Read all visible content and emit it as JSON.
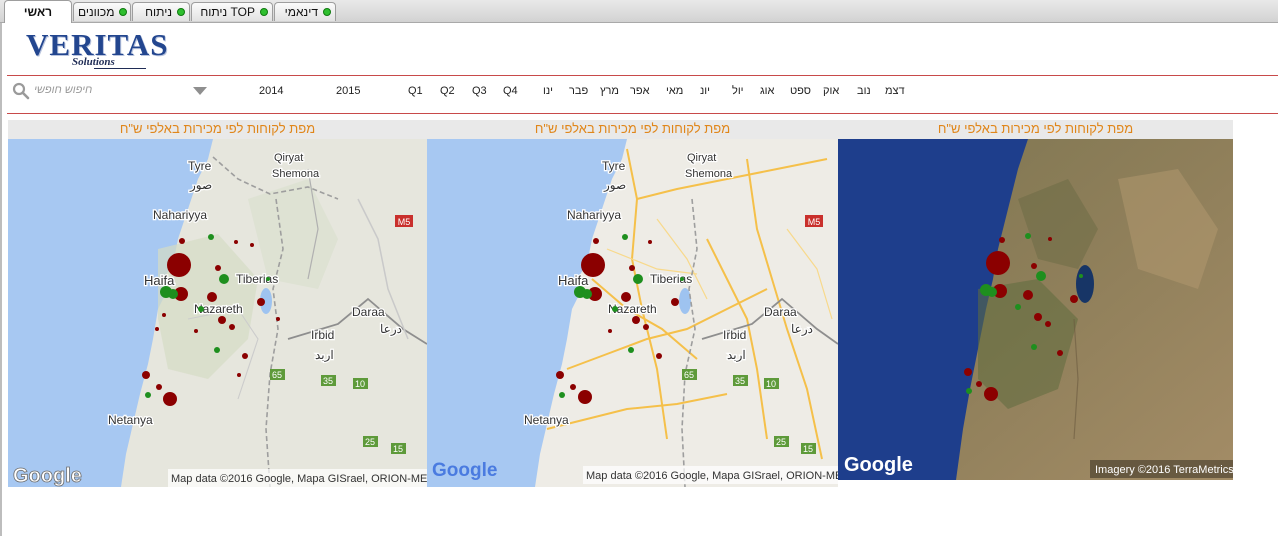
{
  "tabs": [
    {
      "label": "ראשי",
      "active": true
    },
    {
      "label": "מכוונים"
    },
    {
      "label": "ניתוח"
    },
    {
      "label": "ניתוח TOP"
    },
    {
      "label": "דינאמי"
    }
  ],
  "logo": {
    "title": "VERITAS",
    "subtitle": "Solutions"
  },
  "search": {
    "placeholder": "חיפוש חופשי"
  },
  "years": [
    "2014",
    "2015"
  ],
  "quarters": [
    "Q1",
    "Q2",
    "Q3",
    "Q4"
  ],
  "months": [
    "ינו",
    "פבר",
    "מרץ",
    "אפר",
    "מאי",
    "יונ",
    "יול",
    "אוג",
    "ספט",
    "אוק",
    "נוב",
    "דצמ"
  ],
  "panels": [
    {
      "title": "מפת לקוחות לפי מכירות באלפי ש\"ח",
      "map_type": "terrain",
      "attribution": "Map data ©2016 Google, Mapa GISrael, ORION-ME",
      "labels": {
        "tyre": "Tyre",
        "tyre_ar": "صور",
        "qiryat1": "Qiryat",
        "qiryat2": "Shemona",
        "nahariyya": "Nahariyya",
        "haifa": "Haifa",
        "tiberias": "Tiberias",
        "nazareth": "Nazareth",
        "daraa": "Daraa",
        "daraa_ar": "درعا",
        "irbid": "Irbid",
        "irbid_ar": "اربد",
        "netanya": "Netanya"
      },
      "road_shields": {
        "m5": "M5",
        "r65": "65",
        "r35": "35",
        "r10": "10",
        "r25": "25",
        "r15": "15"
      }
    },
    {
      "title": "מפת לקוחות לפי מכירות באלפי ש\"ח",
      "map_type": "roadmap",
      "attribution": "Map data ©2016 Google, Mapa GISrael, ORION-ME",
      "labels": {
        "tyre": "Tyre",
        "tyre_ar": "صور",
        "qiryat1": "Qiryat",
        "qiryat2": "Shemona",
        "nahariyya": "Nahariyya",
        "haifa": "Haifa",
        "tiberias": "Tiberias",
        "nazareth": "Nazareth",
        "daraa": "Daraa",
        "daraa_ar": "درعا",
        "irbid": "Irbid",
        "irbid_ar": "اربد",
        "netanya": "Netanya"
      },
      "road_shields": {
        "m5": "M5",
        "r65": "65",
        "r35": "35",
        "r10": "10",
        "r25": "25",
        "r15": "15"
      }
    },
    {
      "title": "מפת לקוחות לפי מכירות באלפי ש\"ח",
      "map_type": "satellite",
      "attribution": "Imagery ©2016 TerraMetrics"
    }
  ],
  "google_logo": "Google",
  "colors": {
    "accent_title": "#e0861a",
    "marker_red": "#8b0000",
    "marker_green": "#1e8f1e",
    "rule": "#c84a4a"
  }
}
